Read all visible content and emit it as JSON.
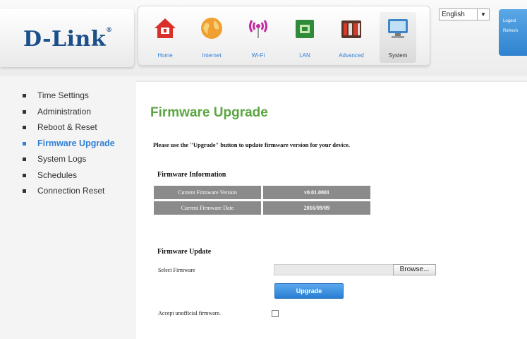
{
  "brand": {
    "logo_text": "D-Link",
    "logo_mark": "®"
  },
  "nav": {
    "items": [
      {
        "label": "Home",
        "icon": "home-icon"
      },
      {
        "label": "Internet",
        "icon": "globe-icon"
      },
      {
        "label": "Wi-Fi",
        "icon": "wifi-icon"
      },
      {
        "label": "LAN",
        "icon": "lan-icon"
      },
      {
        "label": "Advanced",
        "icon": "advanced-icon"
      },
      {
        "label": "System",
        "icon": "system-icon"
      }
    ],
    "active": "System"
  },
  "language": {
    "selected": "English"
  },
  "account": {
    "logout": "Logout",
    "refresh": "Refresh"
  },
  "menu": {
    "items": [
      {
        "label": "Time Settings"
      },
      {
        "label": "Administration"
      },
      {
        "label": "Reboot & Reset"
      },
      {
        "label": "Firmware Upgrade"
      },
      {
        "label": "System Logs"
      },
      {
        "label": "Schedules"
      },
      {
        "label": "Connection Reset"
      }
    ],
    "active": "Firmware Upgrade"
  },
  "page": {
    "title": "Firmware Upgrade",
    "description": "Please use the \"Upgrade\" button to update firmware version for your device."
  },
  "firmware_info": {
    "heading": "Firmware Information",
    "rows": [
      {
        "label": "Current Firmware Version",
        "value": "v0.01.0001"
      },
      {
        "label": "Current Firmware Date",
        "value": "2016/09/09"
      }
    ]
  },
  "firmware_update": {
    "heading": "Firmware Update",
    "select_label": "Select Firmware",
    "browse_label": "Browse...",
    "upgrade_label": "Upgrade",
    "unofficial_label": "Accept unofficial firmware."
  },
  "colors": {
    "brand_blue": "#1b4f8a",
    "accent_blue": "#2f7fd8",
    "title_green": "#5ba541",
    "table_gray": "#8b8b8b"
  }
}
